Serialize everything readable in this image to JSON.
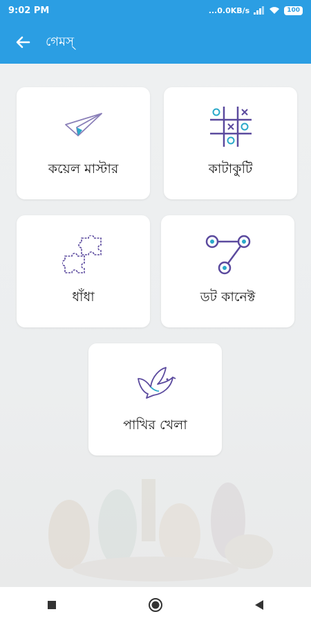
{
  "status_bar": {
    "time": "9:02 PM",
    "network": "...0.0KB/s",
    "battery": "100"
  },
  "app_bar": {
    "title": "গেমস্"
  },
  "games": [
    {
      "label": "কয়েল মাস্টার",
      "icon": "paper-plane-icon"
    },
    {
      "label": "কাটাকুটি",
      "icon": "tic-tac-toe-icon"
    },
    {
      "label": "ধাঁধা",
      "icon": "puzzle-icon"
    },
    {
      "label": "ডট কানেক্ট",
      "icon": "dot-connect-icon"
    },
    {
      "label": "পাখির খেলা",
      "icon": "bird-icon"
    }
  ],
  "nav_bar": {
    "buttons": [
      "recents-button",
      "home-button",
      "back-button"
    ]
  },
  "colors": {
    "primary": "#2b9ee3",
    "icon_accent": "#2aa9c9",
    "icon_stroke": "#5b4a9e"
  }
}
